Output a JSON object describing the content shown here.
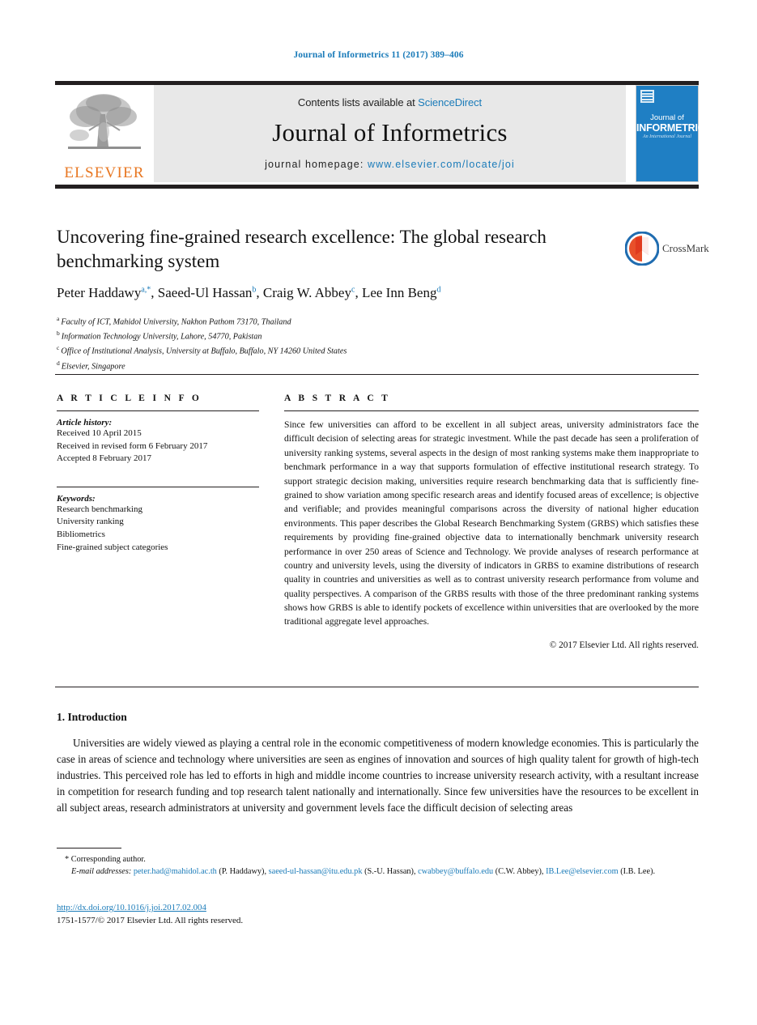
{
  "running_head": "Journal of Informetrics 11 (2017) 389–406",
  "masthead": {
    "publisher_name": "ELSEVIER",
    "contents_prefix": "Contents lists available at ",
    "contents_link": "ScienceDirect",
    "journal_title": "Journal of Informetrics",
    "homepage_prefix": "journal homepage: ",
    "homepage_link": "www.elsevier.com/locate/joi",
    "cover": {
      "line1": "Journal of",
      "line2": "INFORMETRICS",
      "line3": "An International Journal"
    }
  },
  "article": {
    "title": "Uncovering fine-grained research excellence: The global research benchmarking system",
    "crossmark_label": "CrossMark",
    "authors": [
      {
        "name": "Peter Haddawy",
        "marks": "a,*"
      },
      {
        "name": "Saeed-Ul Hassan",
        "marks": "b"
      },
      {
        "name": "Craig W. Abbey",
        "marks": "c"
      },
      {
        "name": "Lee Inn Beng",
        "marks": "d"
      }
    ],
    "affiliations": [
      {
        "mark": "a",
        "text": "Faculty of ICT, Mahidol University, Nakhon Pathom 73170, Thailand"
      },
      {
        "mark": "b",
        "text": "Information Technology University, Lahore, 54770, Pakistan"
      },
      {
        "mark": "c",
        "text": "Office of Institutional Analysis, University at Buffalo, Buffalo, NY 14260 United States"
      },
      {
        "mark": "d",
        "text": "Elsevier, Singapore"
      }
    ]
  },
  "article_info": {
    "heading": "A R T I C L E   I N F O",
    "history_label": "Article history:",
    "history": [
      "Received 10 April 2015",
      "Received in revised form 6 February 2017",
      "Accepted 8 February 2017"
    ],
    "keywords_label": "Keywords:",
    "keywords": [
      "Research benchmarking",
      "University ranking",
      "Bibliometrics",
      "Fine-grained subject categories"
    ]
  },
  "abstract": {
    "heading": "A B S T R A C T",
    "text": "Since few universities can afford to be excellent in all subject areas, university administrators face the difficult decision of selecting areas for strategic investment. While the past decade has seen a proliferation of university ranking systems, several aspects in the design of most ranking systems make them inappropriate to benchmark performance in a way that supports formulation of effective institutional research strategy. To support strategic decision making, universities require research benchmarking data that is sufficiently fine-grained to show variation among specific research areas and identify focused areas of excellence; is objective and verifiable; and provides meaningful comparisons across the diversity of national higher education environments. This paper describes the Global Research Benchmarking System (GRBS) which satisfies these requirements by providing fine-grained objective data to internationally benchmark university research performance in over 250 areas of Science and Technology. We provide analyses of research performance at country and university levels, using the diversity of indicators in GRBS to examine distributions of research quality in countries and universities as well as to contrast university research performance from volume and quality perspectives. A comparison of the GRBS results with those of the three predominant ranking systems shows how GRBS is able to identify pockets of excellence within universities that are overlooked by the more traditional aggregate level approaches.",
    "copyright": "© 2017 Elsevier Ltd. All rights reserved."
  },
  "sections": {
    "intro_heading": "1. Introduction",
    "intro_paragraph": "Universities are widely viewed as playing a central role in the economic competitiveness of modern knowledge economies. This is particularly the case in areas of science and technology where universities are seen as engines of innovation and sources of high quality talent for growth of high-tech industries. This perceived role has led to efforts in high and middle income countries to increase university research activity, with a resultant increase in competition for research funding and top research talent nationally and internationally. Since few universities have the resources to be excellent in all subject areas, research administrators at university and government levels face the difficult decision of selecting areas"
  },
  "footnotes": {
    "corresponding": "* Corresponding author.",
    "email_label": "E-mail addresses:",
    "emails": [
      {
        "address": "peter.had@mahidol.ac.th",
        "owner": "(P. Haddawy)"
      },
      {
        "address": "saeed-ul-hassan@itu.edu.pk",
        "owner": "(S.-U. Hassan)"
      },
      {
        "address": "cwabbey@buffalo.edu",
        "owner": "(C.W. Abbey)"
      },
      {
        "address": "IB.Lee@elsevier.com",
        "owner": "(I.B. Lee)"
      }
    ],
    "doi": "http://dx.doi.org/10.1016/j.joi.2017.02.004",
    "issn_line": "1751-1577/© 2017 Elsevier Ltd. All rights reserved."
  },
  "colors": {
    "link_blue": "#1a7bb9",
    "elsevier_orange": "#e87722",
    "cover_blue": "#1f7fc4",
    "rule_black": "#231f20"
  }
}
